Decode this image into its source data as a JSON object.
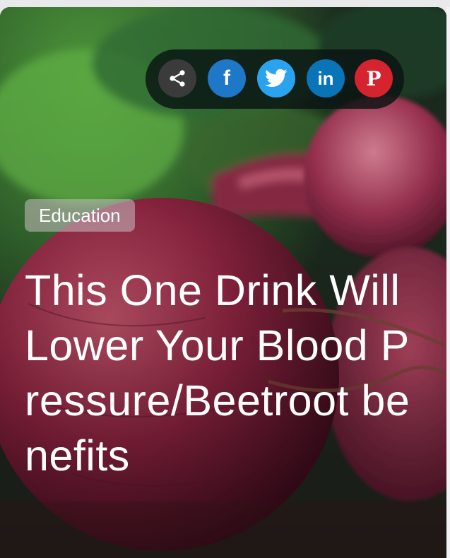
{
  "share": {
    "buttons": [
      {
        "name": "share",
        "icon": "share-icon",
        "color": "#3b3b3b"
      },
      {
        "name": "facebook",
        "icon": "facebook-icon",
        "color": "#1f77c8"
      },
      {
        "name": "twitter",
        "icon": "twitter-icon",
        "color": "#2aa3ef"
      },
      {
        "name": "linkedin",
        "icon": "linkedin-icon",
        "color": "#0a74b8"
      },
      {
        "name": "pinterest",
        "icon": "pinterest-icon",
        "color": "#d5232f"
      }
    ],
    "icon_glyphs": {
      "facebook": "f",
      "linkedin": "in",
      "pinterest": "P"
    }
  },
  "article": {
    "category": "Education",
    "title": "This One Drink Will Lower Your Blood Pressure/Beetroot benefits"
  },
  "colors": {
    "share_bar_bg": "#0a1412",
    "category_bg": "#c8bec3",
    "title_text": "#ffffff"
  }
}
